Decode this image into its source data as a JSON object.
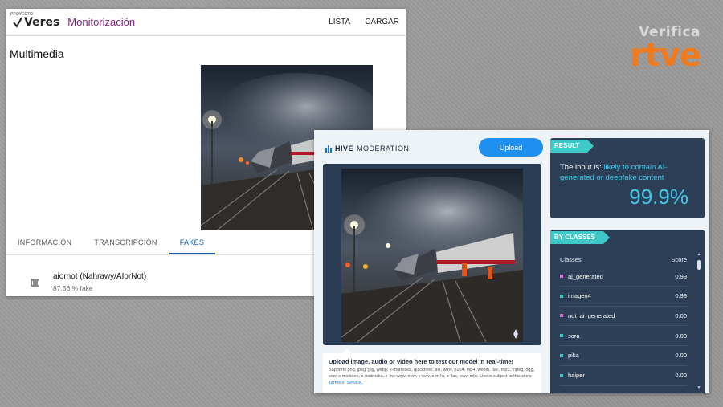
{
  "brand": {
    "verifica": "Verifica",
    "rtve": "rtve"
  },
  "veres": {
    "logo_text": "Veres",
    "logo_small": "PROYECTO",
    "app_title": "Monitorización",
    "nav": [
      "LISTA",
      "CARGAR"
    ],
    "section_title": "Multimedia",
    "tabs": [
      "INFORMACIÓN",
      "TRANSCRIPCIÓN",
      "FAKES"
    ],
    "active_tab": "FAKES",
    "result": {
      "name": "aiornot (Nahrawy/AIorNot)",
      "score": "87,56 % fake"
    }
  },
  "hive": {
    "logo_bold": "HIVE",
    "logo_rest": "MODERATION",
    "upload_label": "Upload",
    "info_heading": "Upload image, audio or video here to test our model in real-time!",
    "info_text": "Supports png, jpeg, jpg, webp, x-matroska, quicktime, avi, wmv, h264, mp4, webm, flac, mp3, mpeg, ogg, wav, x-msvideo, x-matroska, x-ms-wmv, mov, x-wav, x-m4a, x-flac, wav, mkv. Use is subject to this site's",
    "info_link": "Terms of Service",
    "result_tag": "RESULT",
    "result_text_prefix": "The input is:",
    "result_text_highlight": "likely to contain AI-generated or deepfake content",
    "result_percent": "99.9%",
    "classes_tag": "BY CLASSES",
    "classes_header": {
      "label": "Classes",
      "score": "Score"
    },
    "classes": [
      {
        "name": "ai_generated",
        "score": "0.99",
        "color": "#e06fd6"
      },
      {
        "name": "imagen4",
        "score": "0.99",
        "color": "#3ec8c8"
      },
      {
        "name": "not_ai_generated",
        "score": "0.00",
        "color": "#e06fd6"
      },
      {
        "name": "sora",
        "score": "0.00",
        "color": "#3ec8c8"
      },
      {
        "name": "pika",
        "score": "0.00",
        "color": "#3ec8c8"
      },
      {
        "name": "haiper",
        "score": "0.00",
        "color": "#3ec8c8"
      }
    ]
  }
}
